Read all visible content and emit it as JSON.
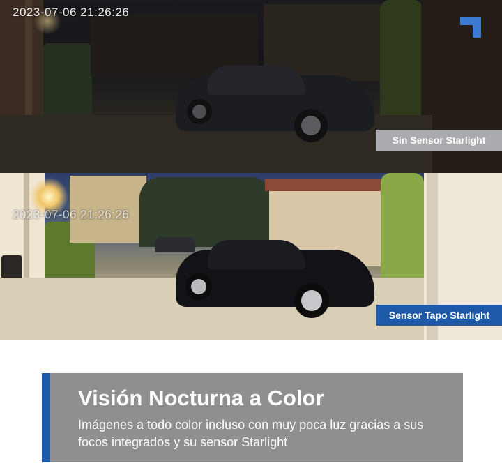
{
  "top_panel": {
    "timestamp": "2023-07-06 21:26:26",
    "label": "Sin Sensor Starlight"
  },
  "bottom_panel": {
    "timestamp": "2023-07-06 21:26:26",
    "label": "Sensor Tapo Starlight"
  },
  "banner": {
    "title": "Visión Nocturna a Color",
    "description": "Imágenes a todo color incluso con muy poca luz gracias a sus focos integrados y su sensor Starlight"
  },
  "colors": {
    "accent_blue": "#1e5aa8",
    "banner_gray": "#8e8f91",
    "label_gray": "#a9abae"
  },
  "icons": [
    "brand-corner-icon"
  ]
}
